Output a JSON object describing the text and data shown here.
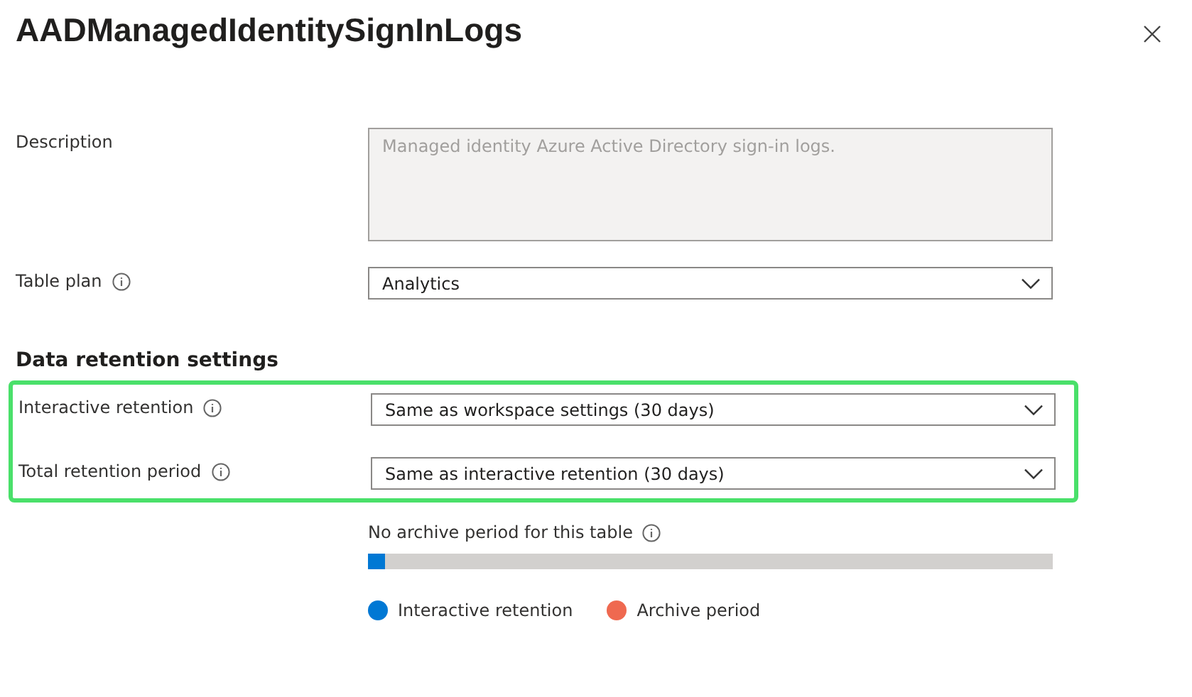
{
  "window": {
    "title": "AADManagedIdentitySignInLogs"
  },
  "fields": [
    {
      "kind": "textarea",
      "label": "Description",
      "info": false,
      "value": "Managed identity Azure Active Directory sign-in logs.",
      "disabled": true
    },
    {
      "kind": "dropdown",
      "label": "Table plan",
      "info": true,
      "value": "Analytics",
      "disabled": false
    }
  ],
  "retention": {
    "heading": "Data retention settings",
    "highlighted": true,
    "fields": [
      {
        "kind": "dropdown",
        "label": "Interactive retention",
        "info": true,
        "value": "Same as workspace settings (30 days)",
        "disabled": false
      },
      {
        "kind": "dropdown",
        "label": "Total retention period",
        "info": true,
        "value": "Same as interactive retention (30 days)",
        "disabled": false
      }
    ]
  },
  "archive": {
    "caption": "No archive period for this table",
    "level": 0.025,
    "legend": [
      {
        "label": "Interactive retention",
        "color": "#0078d4"
      },
      {
        "label": "Archive period",
        "color": "#ef6950"
      }
    ]
  }
}
